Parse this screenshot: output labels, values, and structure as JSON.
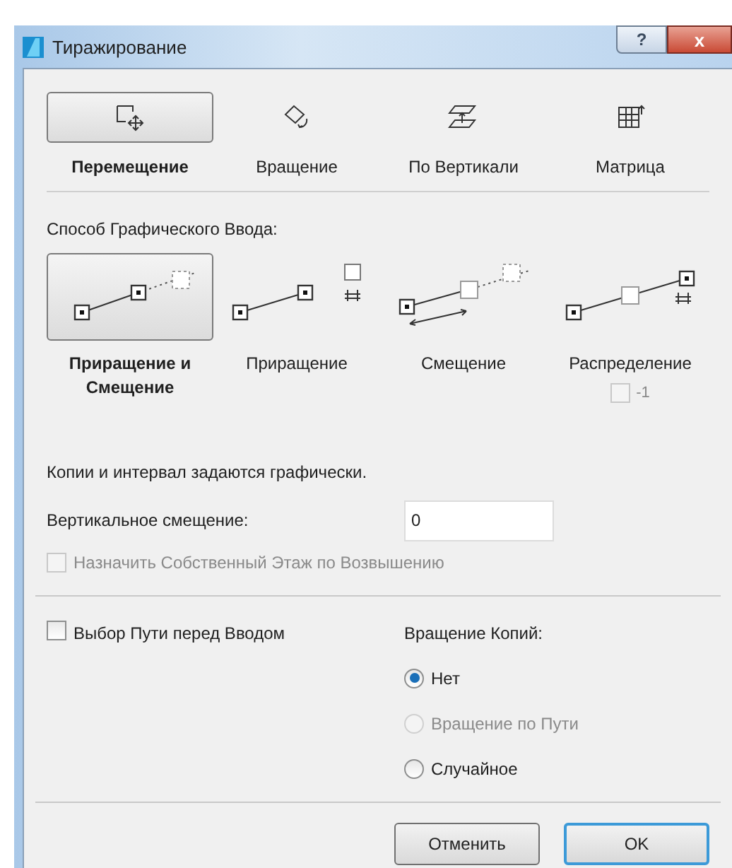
{
  "window": {
    "title": "Тиражирование",
    "help": "?",
    "close": "x"
  },
  "tabs": [
    {
      "label": "Перемещение",
      "kind": "move",
      "selected": true
    },
    {
      "label": "Вращение",
      "kind": "rotate",
      "selected": false
    },
    {
      "label": "По Вертикали",
      "kind": "vertical",
      "selected": false
    },
    {
      "label": "Матрица",
      "kind": "matrix",
      "selected": false
    }
  ],
  "input_method": {
    "label": "Способ Графического Ввода:",
    "methods": [
      {
        "label": "Приращение и Смещение",
        "kind": "increment_offset",
        "selected": true
      },
      {
        "label": "Приращение",
        "kind": "increment",
        "selected": false
      },
      {
        "label": "Смещение",
        "kind": "offset",
        "selected": false
      },
      {
        "label": "Распределение",
        "kind": "distribution",
        "selected": false
      }
    ],
    "minus_one": {
      "label": "-1",
      "checked": false,
      "disabled": true
    }
  },
  "info": "Копии и интервал задаются графически.",
  "vertical_offset": {
    "label": "Вертикальное смещение:",
    "value": "0"
  },
  "own_story": {
    "label": "Назначить Собственный Этаж по Возвышению",
    "checked": false,
    "disabled": true
  },
  "path_first": {
    "label": "Выбор Пути перед Вводом",
    "checked": false,
    "disabled": false
  },
  "rotation": {
    "label": "Вращение Копий:",
    "options": [
      {
        "label": "Нет",
        "selected": true,
        "disabled": false
      },
      {
        "label": "Вращение по Пути",
        "selected": false,
        "disabled": true
      },
      {
        "label": "Случайное",
        "selected": false,
        "disabled": false
      }
    ]
  },
  "buttons": [
    {
      "label": "Отменить",
      "default": false
    },
    {
      "label": "OK",
      "default": true
    }
  ]
}
